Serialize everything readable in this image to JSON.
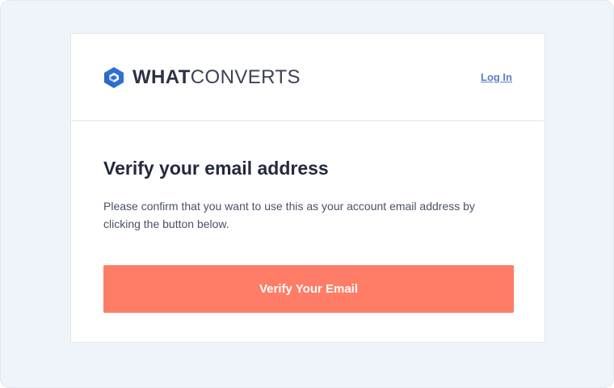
{
  "header": {
    "logo": {
      "text_bold": "WHAT",
      "text_light": "CONVERTS",
      "icon": "whatconverts-logo-icon"
    },
    "login_label": "Log In"
  },
  "main": {
    "title": "Verify your email address",
    "message": "Please confirm that you want to use this as your account email address by clicking the button below.",
    "button_label": "Verify Your Email"
  },
  "colors": {
    "brand_blue": "#2f6fd6",
    "button": "#ff7d67",
    "background": "#eff3fa",
    "link": "#5b7fc6"
  }
}
